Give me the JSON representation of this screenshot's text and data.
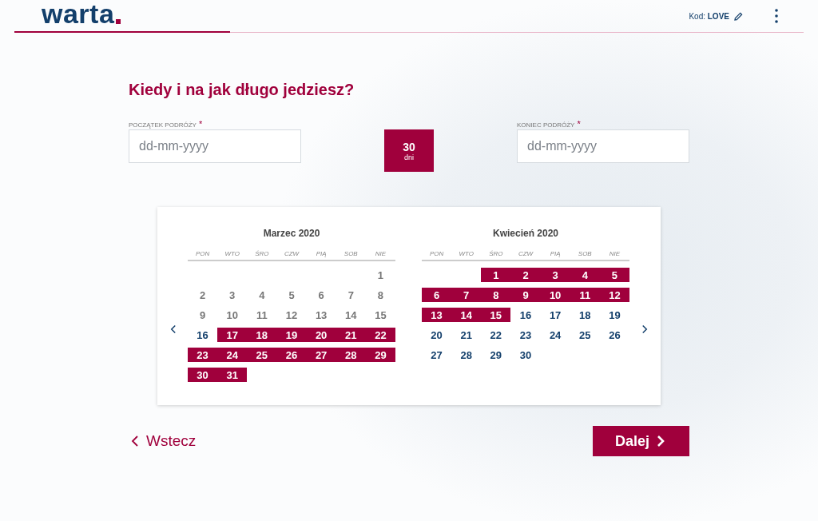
{
  "header": {
    "logo": "warta",
    "code_label": "Kod:",
    "code_value": "LOVE"
  },
  "title": "Kiedy i na jak długo jedziesz?",
  "start_field": {
    "label": "POCZĄTEK PODRÓŻY",
    "required_mark": "*",
    "placeholder": "dd-mm-yyyy"
  },
  "duration": {
    "value": "30",
    "unit": "dni"
  },
  "end_field": {
    "label": "KONIEC PODRÓŻY",
    "required_mark": "*",
    "placeholder": "dd-mm-yyyy"
  },
  "months": [
    {
      "title": "Marzec 2020",
      "weekdays": [
        "PON",
        "WTO",
        "ŚRO",
        "CZW",
        "PIĄ",
        "SOB",
        "NIE"
      ],
      "weeks": [
        {
          "kind": "first",
          "days": [
            {
              "label": "1",
              "kind": "past"
            }
          ]
        },
        {
          "kind": "full",
          "days": [
            {
              "label": "2",
              "kind": "past"
            },
            {
              "label": "3",
              "kind": "past"
            },
            {
              "label": "4",
              "kind": "past"
            },
            {
              "label": "5",
              "kind": "past"
            },
            {
              "label": "6",
              "kind": "past"
            },
            {
              "label": "7",
              "kind": "past"
            },
            {
              "label": "8",
              "kind": "past"
            }
          ]
        },
        {
          "kind": "full",
          "days": [
            {
              "label": "9",
              "kind": "past"
            },
            {
              "label": "10",
              "kind": "past"
            },
            {
              "label": "11",
              "kind": "past"
            },
            {
              "label": "12",
              "kind": "past"
            },
            {
              "label": "13",
              "kind": "past"
            },
            {
              "label": "14",
              "kind": "past"
            },
            {
              "label": "15",
              "kind": "past"
            }
          ]
        },
        {
          "kind": "full",
          "days": [
            {
              "label": "16",
              "kind": "available"
            },
            {
              "label": "17",
              "kind": "in_range"
            },
            {
              "label": "18",
              "kind": "in_range"
            },
            {
              "label": "19",
              "kind": "in_range"
            },
            {
              "label": "20",
              "kind": "in_range"
            },
            {
              "label": "21",
              "kind": "in_range"
            },
            {
              "label": "22",
              "kind": "in_range"
            }
          ]
        },
        {
          "kind": "full",
          "days": [
            {
              "label": "23",
              "kind": "in_range"
            },
            {
              "label": "24",
              "kind": "in_range"
            },
            {
              "label": "25",
              "kind": "in_range"
            },
            {
              "label": "26",
              "kind": "in_range"
            },
            {
              "label": "27",
              "kind": "in_range"
            },
            {
              "label": "28",
              "kind": "in_range"
            },
            {
              "label": "29",
              "kind": "in_range"
            }
          ]
        },
        {
          "kind": "full",
          "days": [
            {
              "label": "30",
              "kind": "in_range"
            },
            {
              "label": "31",
              "kind": "in_range"
            }
          ]
        }
      ]
    },
    {
      "title": "Kwiecień 2020",
      "weekdays": [
        "PON",
        "WTO",
        "ŚRO",
        "CZW",
        "PIĄ",
        "SOB",
        "NIE"
      ],
      "weeks": [
        {
          "kind": "first",
          "days": [
            {
              "label": "1",
              "kind": "in_range"
            },
            {
              "label": "2",
              "kind": "in_range"
            },
            {
              "label": "3",
              "kind": "in_range"
            },
            {
              "label": "4",
              "kind": "in_range"
            },
            {
              "label": "5",
              "kind": "in_range"
            }
          ]
        },
        {
          "kind": "full",
          "days": [
            {
              "label": "6",
              "kind": "in_range"
            },
            {
              "label": "7",
              "kind": "in_range"
            },
            {
              "label": "8",
              "kind": "in_range"
            },
            {
              "label": "9",
              "kind": "in_range"
            },
            {
              "label": "10",
              "kind": "in_range"
            },
            {
              "label": "11",
              "kind": "in_range"
            },
            {
              "label": "12",
              "kind": "in_range"
            }
          ]
        },
        {
          "kind": "full",
          "days": [
            {
              "label": "13",
              "kind": "in_range"
            },
            {
              "label": "14",
              "kind": "in_range"
            },
            {
              "label": "15",
              "kind": "in_range"
            },
            {
              "label": "16",
              "kind": "available"
            },
            {
              "label": "17",
              "kind": "available"
            },
            {
              "label": "18",
              "kind": "available"
            },
            {
              "label": "19",
              "kind": "available"
            }
          ]
        },
        {
          "kind": "full",
          "days": [
            {
              "label": "20",
              "kind": "available"
            },
            {
              "label": "21",
              "kind": "available"
            },
            {
              "label": "22",
              "kind": "available"
            },
            {
              "label": "23",
              "kind": "available"
            },
            {
              "label": "24",
              "kind": "available"
            },
            {
              "label": "25",
              "kind": "available"
            },
            {
              "label": "26",
              "kind": "available"
            }
          ]
        },
        {
          "kind": "full",
          "days": [
            {
              "label": "27",
              "kind": "available"
            },
            {
              "label": "28",
              "kind": "available"
            },
            {
              "label": "29",
              "kind": "available"
            },
            {
              "label": "30",
              "kind": "available"
            }
          ]
        }
      ]
    }
  ],
  "back_link": {
    "label": "Wstecz"
  },
  "next_button": {
    "label": "Dalej"
  }
}
